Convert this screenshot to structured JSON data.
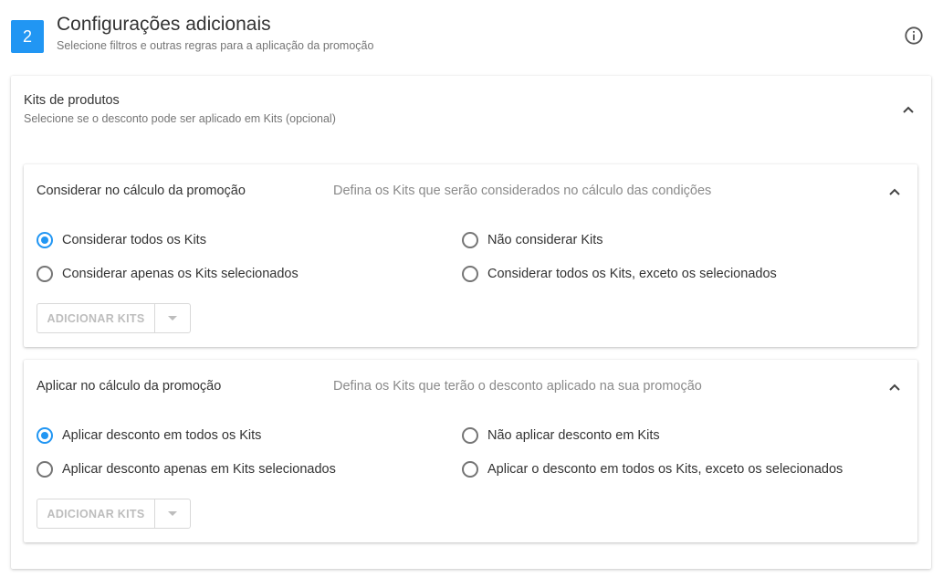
{
  "step": {
    "number": "2",
    "title": "Configurações adicionais",
    "subtitle": "Selecione filtros e outras regras para a aplicação da promoção",
    "info_icon": "info-icon"
  },
  "kits": {
    "title": "Kits de produtos",
    "subtitle": "Selecione se o desconto pode ser aplicado em Kits (opcional)",
    "expanded": true,
    "sections": [
      {
        "title": "Considerar no cálculo da promoção",
        "description": "Defina os Kits que serão considerados no cálculo das condições",
        "options": [
          {
            "label": "Considerar todos os Kits",
            "checked": true
          },
          {
            "label": "Não considerar Kits",
            "checked": false
          },
          {
            "label": "Considerar apenas os Kits selecionados",
            "checked": false
          },
          {
            "label": "Considerar todos os Kits, exceto os selecionados",
            "checked": false
          }
        ],
        "add_button": "ADICIONAR KITS"
      },
      {
        "title": "Aplicar no cálculo da promoção",
        "description": "Defina os Kits que terão o desconto aplicado na sua promoção",
        "options": [
          {
            "label": "Aplicar desconto em todos os Kits",
            "checked": true
          },
          {
            "label": "Não aplicar desconto em Kits",
            "checked": false
          },
          {
            "label": "Aplicar desconto apenas em Kits selecionados",
            "checked": false
          },
          {
            "label": "Aplicar o desconto em todos os Kits, exceto os selecionados",
            "checked": false
          }
        ],
        "add_button": "ADICIONAR KITS"
      }
    ]
  },
  "colors": {
    "accent": "#2196f3",
    "text": "#333333",
    "muted": "#757575",
    "disabled": "#bdbdbd"
  }
}
